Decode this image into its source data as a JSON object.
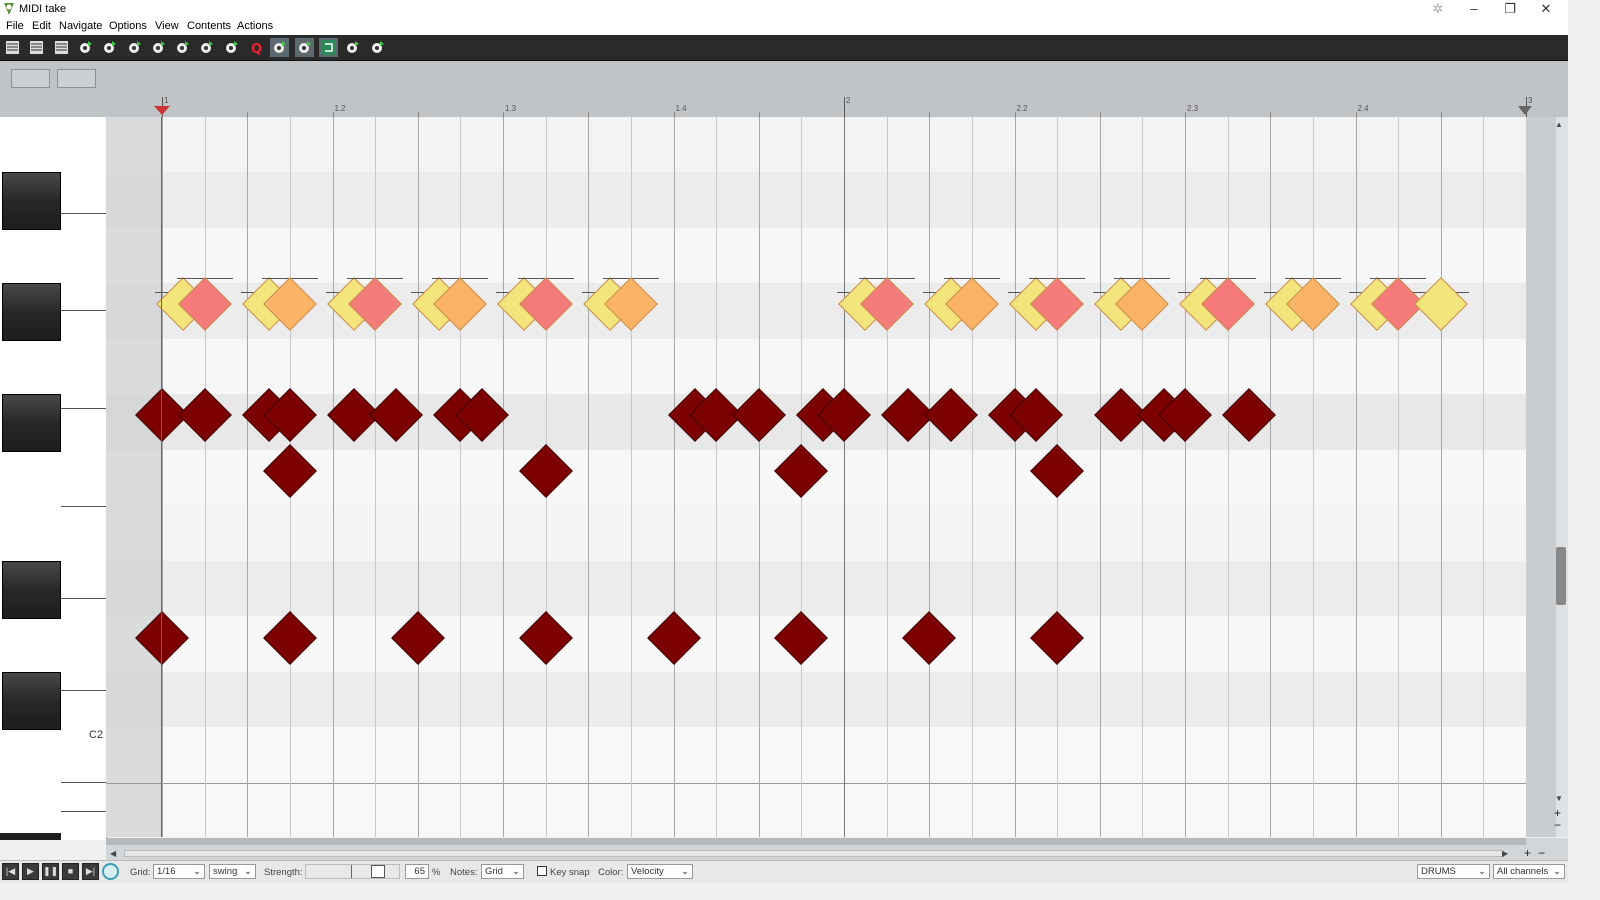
{
  "window": {
    "title": "MIDI take"
  },
  "menu": [
    "File",
    "Edit",
    "Navigate",
    "Options",
    "View",
    "Contents",
    "Actions"
  ],
  "toolbar_icons": [
    "view-list-icon",
    "view-events-icon",
    "view-grid-icon",
    "notation-icon",
    "insert-note-icon",
    "humanize-icon",
    "quantize-icon",
    "step-input-icon",
    "chord-icon",
    "grid-snap-icon",
    "quantize-q-icon",
    "wrench-icon",
    "velocity-lane-icon",
    "loop-icon",
    "metronome-icon",
    "record-icon"
  ],
  "ruler": {
    "labels": [
      "1",
      "1.2",
      "1.3",
      "1.4",
      "2",
      "2.2",
      "2.3",
      "2.4",
      "3"
    ]
  },
  "piano": {
    "c_label": "C2"
  },
  "notes": [
    {
      "beat": 0.25,
      "lane": 0,
      "vel": "lo"
    },
    {
      "beat": 0.5,
      "lane": 0,
      "vel": "hi"
    },
    {
      "beat": 1.25,
      "lane": 0,
      "vel": "lo"
    },
    {
      "beat": 1.5,
      "lane": 0,
      "vel": "mid"
    },
    {
      "beat": 2.25,
      "lane": 0,
      "vel": "lo"
    },
    {
      "beat": 2.5,
      "lane": 0,
      "vel": "hi"
    },
    {
      "beat": 3.25,
      "lane": 0,
      "vel": "lo"
    },
    {
      "beat": 3.5,
      "lane": 0,
      "vel": "mid"
    },
    {
      "beat": 4.25,
      "lane": 0,
      "vel": "lo"
    },
    {
      "beat": 4.5,
      "lane": 0,
      "vel": "hi"
    },
    {
      "beat": 5.25,
      "lane": 0,
      "vel": "lo"
    },
    {
      "beat": 5.5,
      "lane": 0,
      "vel": "mid"
    },
    {
      "beat": 8.25,
      "lane": 0,
      "vel": "lo"
    },
    {
      "beat": 8.5,
      "lane": 0,
      "vel": "hi"
    },
    {
      "beat": 9.25,
      "lane": 0,
      "vel": "lo"
    },
    {
      "beat": 9.5,
      "lane": 0,
      "vel": "mid"
    },
    {
      "beat": 10.25,
      "lane": 0,
      "vel": "lo"
    },
    {
      "beat": 10.5,
      "lane": 0,
      "vel": "hi"
    },
    {
      "beat": 11.25,
      "lane": 0,
      "vel": "lo"
    },
    {
      "beat": 11.5,
      "lane": 0,
      "vel": "mid"
    },
    {
      "beat": 12.25,
      "lane": 0,
      "vel": "lo"
    },
    {
      "beat": 12.5,
      "lane": 0,
      "vel": "hi"
    },
    {
      "beat": 13.25,
      "lane": 0,
      "vel": "lo"
    },
    {
      "beat": 13.5,
      "lane": 0,
      "vel": "mid"
    },
    {
      "beat": 14.25,
      "lane": 0,
      "vel": "lo"
    },
    {
      "beat": 14.5,
      "lane": 0,
      "vel": "hi"
    },
    {
      "beat": 15.0,
      "lane": 0,
      "vel": "lo"
    },
    {
      "beat": 0,
      "lane": 2,
      "vel": "max"
    },
    {
      "beat": 0.5,
      "lane": 2,
      "vel": "max"
    },
    {
      "beat": 1.25,
      "lane": 2,
      "vel": "max"
    },
    {
      "beat": 1.5,
      "lane": 2,
      "vel": "max"
    },
    {
      "beat": 2.25,
      "lane": 2,
      "vel": "max"
    },
    {
      "beat": 2.75,
      "lane": 2,
      "vel": "max"
    },
    {
      "beat": 3.5,
      "lane": 2,
      "vel": "max"
    },
    {
      "beat": 3.75,
      "lane": 2,
      "vel": "max"
    },
    {
      "beat": 6.25,
      "lane": 2,
      "vel": "max"
    },
    {
      "beat": 6.5,
      "lane": 2,
      "vel": "max"
    },
    {
      "beat": 7.0,
      "lane": 2,
      "vel": "max"
    },
    {
      "beat": 7.75,
      "lane": 2,
      "vel": "max"
    },
    {
      "beat": 8.0,
      "lane": 2,
      "vel": "max"
    },
    {
      "beat": 8.75,
      "lane": 2,
      "vel": "max"
    },
    {
      "beat": 9.25,
      "lane": 2,
      "vel": "max"
    },
    {
      "beat": 10.0,
      "lane": 2,
      "vel": "max"
    },
    {
      "beat": 10.25,
      "lane": 2,
      "vel": "max"
    },
    {
      "beat": 11.25,
      "lane": 2,
      "vel": "max"
    },
    {
      "beat": 11.75,
      "lane": 2,
      "vel": "max"
    },
    {
      "beat": 12.0,
      "lane": 2,
      "vel": "max"
    },
    {
      "beat": 12.75,
      "lane": 2,
      "vel": "max"
    },
    {
      "beat": 1.5,
      "lane": 3,
      "vel": "max"
    },
    {
      "beat": 4.5,
      "lane": 3,
      "vel": "max"
    },
    {
      "beat": 7.5,
      "lane": 3,
      "vel": "max"
    },
    {
      "beat": 10.5,
      "lane": 3,
      "vel": "max"
    },
    {
      "beat": 0,
      "lane": 6,
      "vel": "max"
    },
    {
      "beat": 1.5,
      "lane": 6,
      "vel": "max"
    },
    {
      "beat": 3.0,
      "lane": 6,
      "vel": "max"
    },
    {
      "beat": 4.5,
      "lane": 6,
      "vel": "max"
    },
    {
      "beat": 6.0,
      "lane": 6,
      "vel": "max"
    },
    {
      "beat": 7.5,
      "lane": 6,
      "vel": "max"
    },
    {
      "beat": 9.0,
      "lane": 6,
      "vel": "max"
    },
    {
      "beat": 10.5,
      "lane": 6,
      "vel": "max"
    }
  ],
  "bottom": {
    "grid_label": "Grid:",
    "grid_value": "1/16",
    "swing_value": "swing",
    "strength_label": "Strength:",
    "strength_value": "65",
    "percent": "%",
    "notes_label": "Notes:",
    "notes_value": "Grid",
    "keysnap_label": "Key snap",
    "color_label": "Color:",
    "color_value": "Velocity",
    "track_value": "DRUMS",
    "channels_value": "All channels"
  },
  "colors": {
    "lo": "#f3e47c",
    "mid": "#fbb467",
    "hi": "#f57b7b",
    "max": "#7d0000"
  }
}
